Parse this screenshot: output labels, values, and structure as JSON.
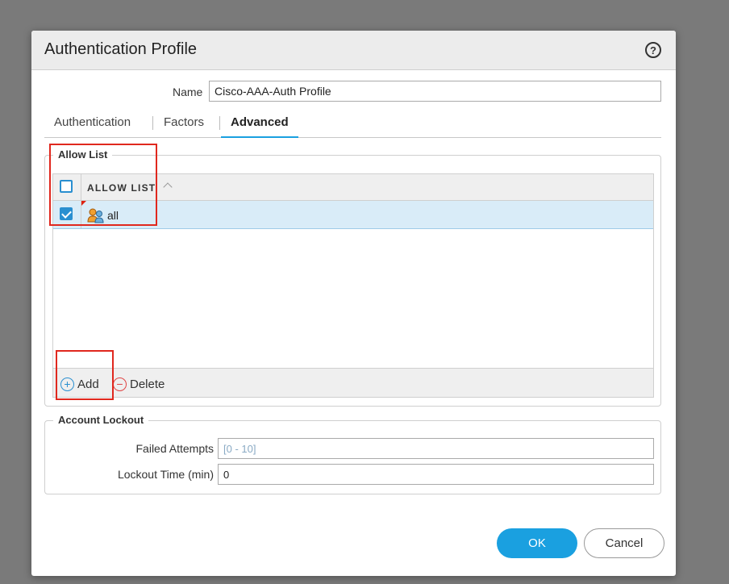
{
  "dialog": {
    "title": "Authentication Profile",
    "help_icon": "?"
  },
  "name_field": {
    "label": "Name",
    "value": "Cisco-AAA-Auth Profile"
  },
  "tabs": [
    {
      "label": "Authentication",
      "active": false
    },
    {
      "label": "Factors",
      "active": false
    },
    {
      "label": "Advanced",
      "active": true
    }
  ],
  "allow_list": {
    "legend": "Allow List",
    "column_header": "ALLOW LIST",
    "rows": [
      {
        "label": "all",
        "checked": true,
        "icon": "user-group-icon"
      }
    ],
    "add_label": "Add",
    "delete_label": "Delete"
  },
  "account_lockout": {
    "legend": "Account Lockout",
    "failed_attempts_label": "Failed Attempts",
    "failed_attempts_placeholder": "[0 - 10]",
    "lockout_time_label": "Lockout Time (min)",
    "lockout_time_value": "0"
  },
  "buttons": {
    "ok": "OK",
    "cancel": "Cancel"
  },
  "colors": {
    "accent": "#1aa0e0",
    "highlight_box": "#e0281e",
    "selected_row": "#d9ecf8"
  }
}
